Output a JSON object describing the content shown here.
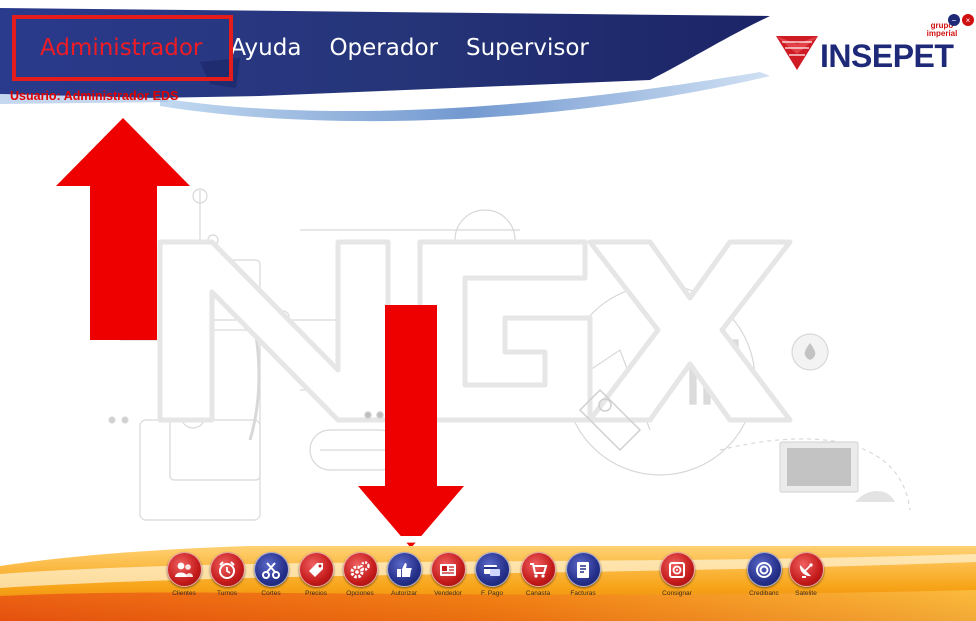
{
  "menu": {
    "items": [
      {
        "label": "Administrador",
        "active": true
      },
      {
        "label": "Ayuda",
        "active": false
      },
      {
        "label": "Operador",
        "active": false
      },
      {
        "label": "Supervisor",
        "active": false
      }
    ]
  },
  "user_label": "Usuario: Administrador EDS",
  "logo": {
    "name": "INSEPET",
    "sub": "grupo imperial"
  },
  "watermark_text": "NGX",
  "toolbar": [
    {
      "label": "Clientes",
      "icon": "users-icon",
      "color": "red"
    },
    {
      "label": "Turnos",
      "icon": "clock-icon",
      "color": "red"
    },
    {
      "label": "Cortes",
      "icon": "scissors-icon",
      "color": "blue"
    },
    {
      "label": "Precios",
      "icon": "price-tag-icon",
      "color": "red"
    },
    {
      "label": "Opciones",
      "icon": "gears-icon",
      "color": "red"
    },
    {
      "label": "Autorizar",
      "icon": "thumbs-up-icon",
      "color": "blue"
    },
    {
      "label": "Vendedor",
      "icon": "id-card-icon",
      "color": "red"
    },
    {
      "label": "F. Pago",
      "icon": "credit-card-icon",
      "color": "blue"
    },
    {
      "label": "Canasta",
      "icon": "shopping-cart-icon",
      "color": "red"
    },
    {
      "label": "Facturas",
      "icon": "invoice-icon",
      "color": "blue"
    },
    {
      "label": "Consignar",
      "icon": "safe-icon",
      "color": "red"
    },
    {
      "label": "Credibanc",
      "icon": "target-icon",
      "color": "blue"
    },
    {
      "label": "Satelite",
      "icon": "satellite-dish-icon",
      "color": "red"
    }
  ],
  "colors": {
    "header_blue": "#1e2a78",
    "active_red": "#ee1c24",
    "arrow_red": "#ee0000",
    "toolbar_orange": "#f5a623"
  }
}
